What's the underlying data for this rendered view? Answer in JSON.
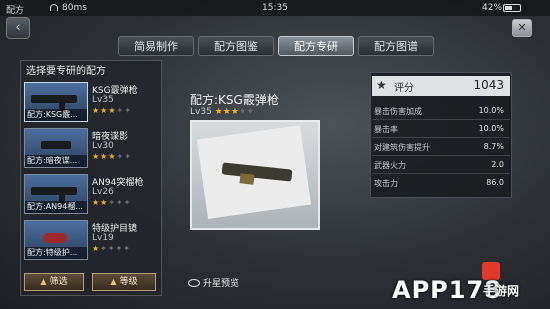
{
  "status": {
    "carrier": "配方",
    "speed": "80ms",
    "time": "15:35",
    "battery": "42%",
    "battery_level": 0.42
  },
  "tabs": [
    {
      "label": "简易制作"
    },
    {
      "label": "配方图鉴"
    },
    {
      "label": "配方专研"
    },
    {
      "label": "配方图谱"
    }
  ],
  "list": {
    "title": "选择要专研的配方",
    "items": [
      {
        "name": "KSG霰弹枪",
        "level": "Lv35",
        "caption": "配方:KSG霰...",
        "stars": 3
      },
      {
        "name": "暗夜谍影",
        "level": "Lv30",
        "caption": "配方:暗夜谍...",
        "stars": 3
      },
      {
        "name": "AN94突榴枪",
        "level": "Lv26",
        "caption": "配方:AN94榴...",
        "stars": 2
      },
      {
        "name": "特级护目镜",
        "level": "Lv19",
        "caption": "配方:特级护...",
        "stars": 1
      }
    ],
    "filter_label": "筛选",
    "level_label": "等级"
  },
  "recipe": {
    "title": "配方:KSG霰弹枪",
    "level": "Lv35",
    "stars": 3,
    "preview_label": "升星预览"
  },
  "stats": {
    "score_label": "评分",
    "score_value": "1043",
    "rows": [
      {
        "k": "暴击伤害加成",
        "v": "10.0%"
      },
      {
        "k": "暴击率",
        "v": "10.0%"
      },
      {
        "k": "对建筑伤害提升",
        "v": "8.7%"
      },
      {
        "k": "武器火力",
        "v": "2.0"
      },
      {
        "k": "攻击力",
        "v": "86.0"
      }
    ]
  },
  "watermark": {
    "main": "APP178",
    "sub": "手游网"
  }
}
